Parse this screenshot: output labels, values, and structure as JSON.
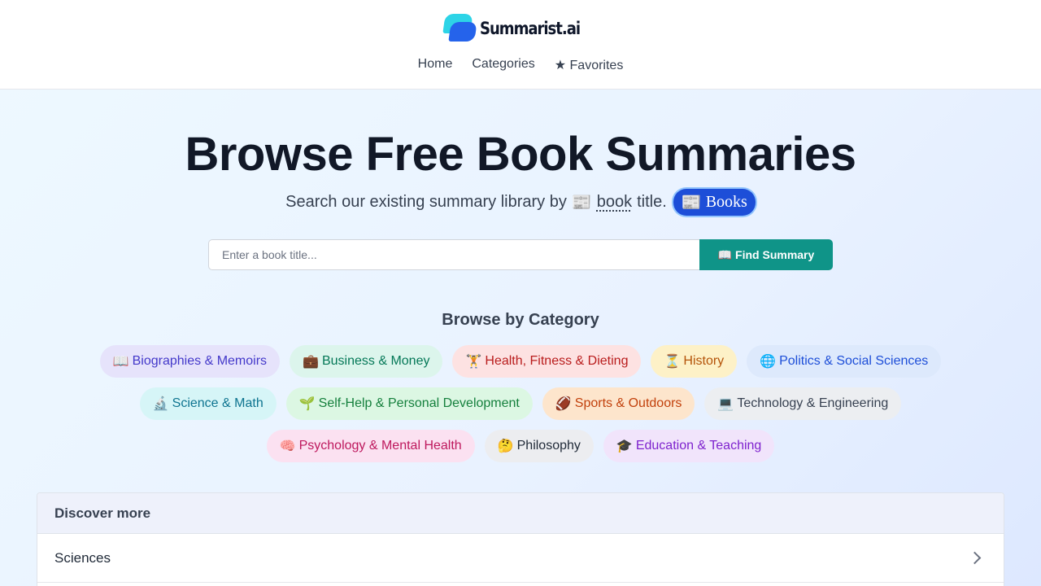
{
  "brand": {
    "name": "Summarist.ai"
  },
  "nav": {
    "home": "Home",
    "categories": "Categories",
    "favorites": "★ Favorites"
  },
  "hero": {
    "title": "Browse Free Book Summaries",
    "subtitle_before": "Search our existing summary library by",
    "subtitle_icon": "📰",
    "subtitle_word": "book",
    "subtitle_after": "title.",
    "badge_icon": "📰",
    "badge_label": "Books"
  },
  "search": {
    "placeholder": "Enter a book title...",
    "value": "",
    "button_label": "📖 Find Summary"
  },
  "browse": {
    "title": "Browse by Category",
    "categories": [
      {
        "emoji": "📖",
        "label": "Biographies & Memoirs",
        "bg": "#e6e3fb",
        "fg": "#4338ca"
      },
      {
        "emoji": "💼",
        "label": "Business & Money",
        "bg": "#dcf5ec",
        "fg": "#047857"
      },
      {
        "emoji": "🏋️",
        "label": "Health, Fitness & Dieting",
        "bg": "#fde2e2",
        "fg": "#b91c1c"
      },
      {
        "emoji": "⏳",
        "label": "History",
        "bg": "#fdf1c7",
        "fg": "#b45309"
      },
      {
        "emoji": "🌐",
        "label": "Politics & Social Sciences",
        "bg": "#dde9fc",
        "fg": "#1d4ed8"
      },
      {
        "emoji": "🔬",
        "label": "Science & Math",
        "bg": "#d6f5f7",
        "fg": "#0e7490"
      },
      {
        "emoji": "🌱",
        "label": "Self-Help & Personal Development",
        "bg": "#dcf7e3",
        "fg": "#15803d"
      },
      {
        "emoji": "🏈",
        "label": "Sports & Outdoors",
        "bg": "#fde5cc",
        "fg": "#c2410c"
      },
      {
        "emoji": "💻",
        "label": "Technology & Engineering",
        "bg": "#eceef1",
        "fg": "#374151"
      },
      {
        "emoji": "🧠",
        "label": "Psychology & Mental Health",
        "bg": "#fbe1f1",
        "fg": "#be185d"
      },
      {
        "emoji": "🤔",
        "label": "Philosophy",
        "bg": "#ecedf0",
        "fg": "#1f2937"
      },
      {
        "emoji": "🎓",
        "label": "Education & Teaching",
        "bg": "#f1e4fb",
        "fg": "#7e22ce"
      }
    ]
  },
  "discover": {
    "title": "Discover more",
    "items": [
      {
        "label": "Sciences"
      }
    ]
  }
}
